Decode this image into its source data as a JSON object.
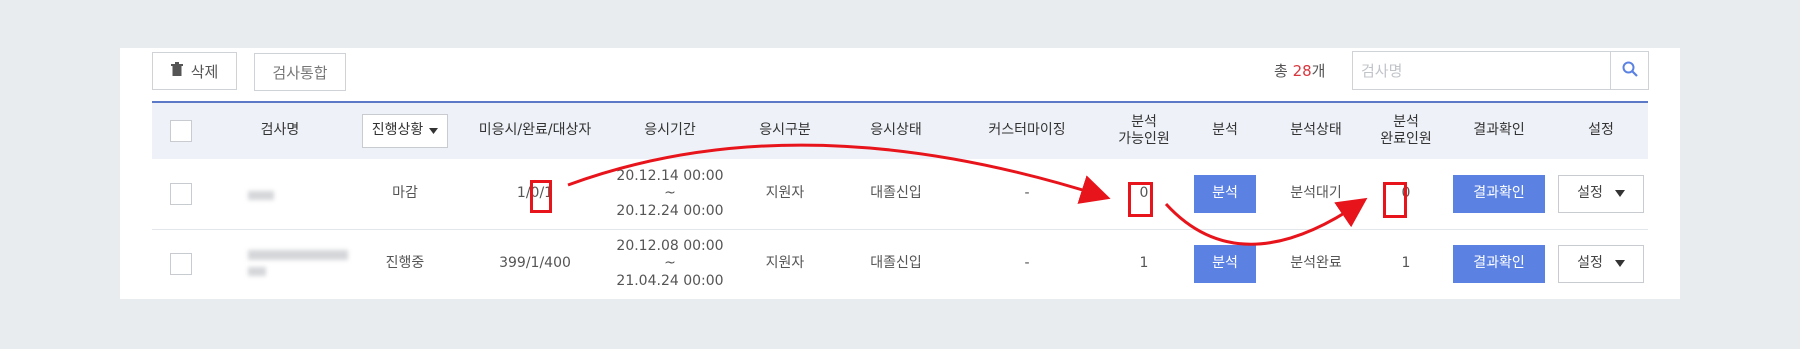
{
  "toolbar": {
    "delete_label": "삭제",
    "merge_label": "검사통합",
    "count_prefix": "총 ",
    "count_value": "28",
    "count_suffix": "개",
    "search_placeholder": "검사명"
  },
  "columns": {
    "name": "검사명",
    "progress": "진행상황",
    "counts": "미응시/완료/대상자",
    "period": "응시기간",
    "type": "응시구분",
    "status": "응시상태",
    "custom": "커스터마이징",
    "analyzable_1": "분석",
    "analyzable_2": "가능인원",
    "analyze": "분석",
    "analysis_status": "분석상태",
    "analyzed_1": "분석",
    "analyzed_2": "완료인원",
    "result": "결과확인",
    "settings": "설정"
  },
  "rows": [
    {
      "progress": "마감",
      "counts": "1/0/1",
      "period_start": "20.12.14 00:00 ~",
      "period_end": "20.12.24 00:00",
      "type": "지원자",
      "status": "대졸신입",
      "custom": "-",
      "analyzable": "0",
      "analyze_btn": "분석",
      "analysis_status": "분석대기",
      "analyzed": "0",
      "result_btn": "결과확인",
      "settings_btn": "설정"
    },
    {
      "progress": "진행중",
      "counts": "399/1/400",
      "period_start": "20.12.08 00:00 ~",
      "period_end": "21.04.24 00:00",
      "type": "지원자",
      "status": "대졸신입",
      "custom": "-",
      "analyzable": "1",
      "analyze_btn": "분석",
      "analysis_status": "분석완료",
      "analyzed": "1",
      "result_btn": "결과확인",
      "settings_btn": "설정"
    }
  ],
  "colors": {
    "accent_blue": "#5b82e3",
    "header_bg": "#eef2f8",
    "annotation_red": "#e8141c",
    "count_red": "#d9363e"
  },
  "icons": [
    "trash-icon",
    "search-icon",
    "caret-down-icon"
  ]
}
